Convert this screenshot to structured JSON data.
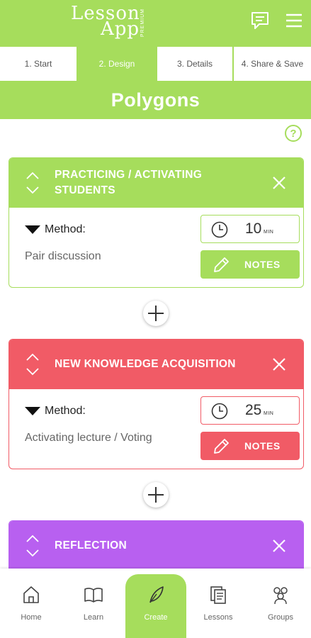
{
  "header": {
    "logo_line1": "Lesson",
    "logo_line2": "App",
    "logo_badge": "PREMIUM",
    "chat_icon": "chat-bubble-icon",
    "menu_icon": "hamburger-menu-icon"
  },
  "tabs": [
    {
      "label": "1. Start",
      "active": false
    },
    {
      "label": "2. Design",
      "active": true
    },
    {
      "label": "3. Details",
      "active": false
    },
    {
      "label": "4. Share & Save",
      "active": false
    }
  ],
  "page": {
    "title": "Polygons",
    "help_label": "?"
  },
  "cards": [
    {
      "title": "PRACTICING / ACTIVATING STUDENTS",
      "color": "#a6dd5c",
      "method_label": "Method:",
      "method_value": "Pair discussion",
      "time_value": "10",
      "time_unit": "MIN",
      "notes_label": "NOTES"
    },
    {
      "title": "NEW KNOWLEDGE ACQUISITION",
      "color": "#f15b66",
      "method_label": "Method:",
      "method_value": "Activating lecture / Voting",
      "time_value": "25",
      "time_unit": "MIN",
      "notes_label": "NOTES"
    },
    {
      "title": "REFLECTION",
      "color": "#b860f0"
    }
  ],
  "bottom_nav": [
    {
      "label": "Home",
      "icon": "home-icon",
      "active": false
    },
    {
      "label": "Learn",
      "icon": "book-icon",
      "active": false
    },
    {
      "label": "Create",
      "icon": "feather-icon",
      "active": true
    },
    {
      "label": "Lessons",
      "icon": "documents-icon",
      "active": false
    },
    {
      "label": "Groups",
      "icon": "people-icon",
      "active": false
    }
  ],
  "colors": {
    "accent_green": "#a6dd5c",
    "accent_red": "#f15b66",
    "accent_purple": "#b860f0"
  }
}
